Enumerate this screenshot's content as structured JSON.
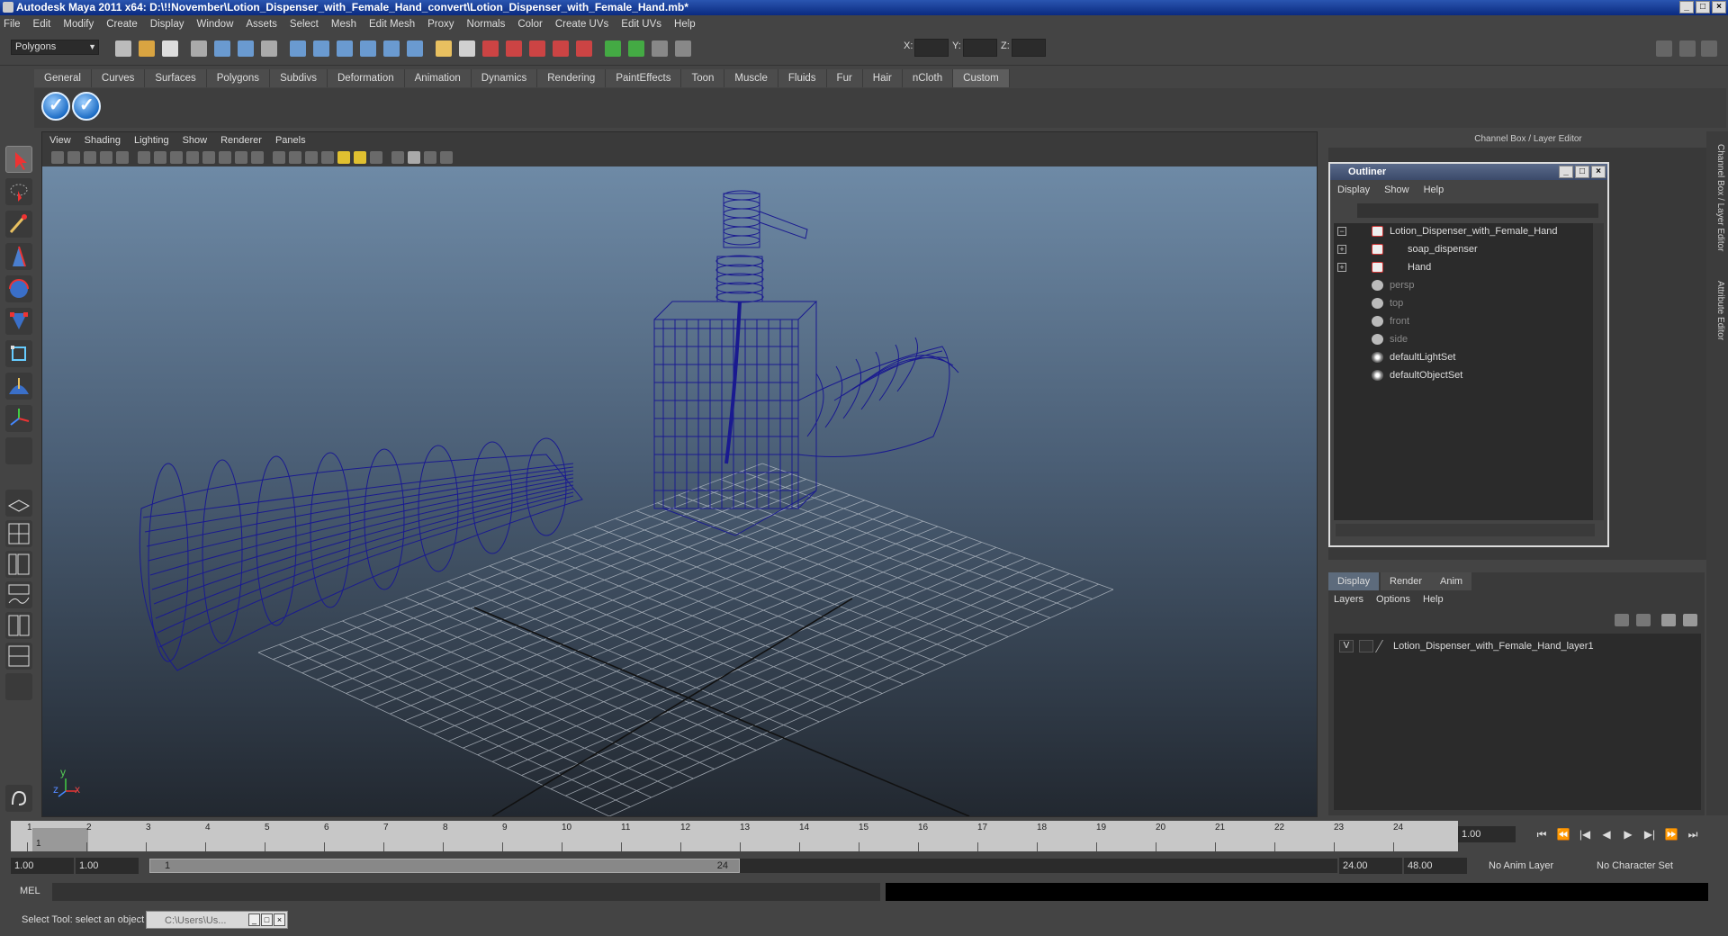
{
  "window": {
    "title": "Autodesk Maya 2011 x64: D:\\!!November\\Lotion_Dispenser_with_Female_Hand_convert\\Lotion_Dispenser_with_Female_Hand.mb*"
  },
  "menu": [
    "File",
    "Edit",
    "Modify",
    "Create",
    "Display",
    "Window",
    "Assets",
    "Select",
    "Mesh",
    "Edit Mesh",
    "Proxy",
    "Normals",
    "Color",
    "Create UVs",
    "Edit UVs",
    "Help"
  ],
  "status": {
    "mode": "Polygons",
    "x_label": "X:",
    "y_label": "Y:",
    "z_label": "Z:"
  },
  "shelf": {
    "tabs": [
      "General",
      "Curves",
      "Surfaces",
      "Polygons",
      "Subdivs",
      "Deformation",
      "Animation",
      "Dynamics",
      "Rendering",
      "PaintEffects",
      "Toon",
      "Muscle",
      "Fluids",
      "Fur",
      "Hair",
      "nCloth",
      "Custom"
    ],
    "active_tab": "Custom"
  },
  "viewport": {
    "menu": [
      "View",
      "Shading",
      "Lighting",
      "Show",
      "Renderer",
      "Panels"
    ],
    "axis_y": "y",
    "axis_x": "x",
    "axis_z": "z"
  },
  "right_panel": {
    "header": "Channel Box / Layer Editor",
    "vertical_tabs": [
      "Channel Box / Layer Editor",
      "Attribute Editor"
    ]
  },
  "outliner": {
    "title": "Outliner",
    "menu": [
      "Display",
      "Show",
      "Help"
    ],
    "items": [
      {
        "label": "Lotion_Dispenser_with_Female_Hand",
        "type": "transform",
        "expand": "−",
        "indent": 0,
        "dim": false
      },
      {
        "label": "soap_dispenser",
        "type": "transform",
        "expand": "+",
        "indent": 1,
        "dim": false
      },
      {
        "label": "Hand",
        "type": "transform",
        "expand": "+",
        "indent": 1,
        "dim": false
      },
      {
        "label": "persp",
        "type": "camera",
        "expand": "",
        "indent": 0,
        "dim": true
      },
      {
        "label": "top",
        "type": "camera",
        "expand": "",
        "indent": 0,
        "dim": true
      },
      {
        "label": "front",
        "type": "camera",
        "expand": "",
        "indent": 0,
        "dim": true
      },
      {
        "label": "side",
        "type": "camera",
        "expand": "",
        "indent": 0,
        "dim": true
      },
      {
        "label": "defaultLightSet",
        "type": "set",
        "expand": "",
        "indent": 0,
        "dim": false
      },
      {
        "label": "defaultObjectSet",
        "type": "set",
        "expand": "",
        "indent": 0,
        "dim": false
      }
    ]
  },
  "layer_editor": {
    "tabs": [
      "Display",
      "Render",
      "Anim"
    ],
    "active_tab": "Display",
    "menu": [
      "Layers",
      "Options",
      "Help"
    ],
    "layers": [
      {
        "visible": "V",
        "name": "Lotion_Dispenser_with_Female_Hand_layer1"
      }
    ]
  },
  "timeline": {
    "ticks": [
      "1",
      "2",
      "3",
      "4",
      "5",
      "6",
      "7",
      "8",
      "9",
      "10",
      "11",
      "12",
      "13",
      "14",
      "15",
      "16",
      "17",
      "18",
      "19",
      "20",
      "21",
      "22",
      "23",
      "24"
    ],
    "current_frame": "1",
    "current_field": "1.00"
  },
  "playback": {
    "buttons": [
      "⏮",
      "⏪",
      "|◀",
      "◀",
      "▶",
      "▶|",
      "⏩",
      "⏭"
    ]
  },
  "range": {
    "start": "1.00",
    "playback_start": "1.00",
    "thumb_start": "1",
    "thumb_end": "24",
    "playback_end": "24.00",
    "end": "48.00",
    "anim_layer": "No Anim Layer",
    "character_set": "No Character Set"
  },
  "command": {
    "label": "MEL"
  },
  "help": {
    "message": "Select Tool: select an object",
    "task": "C:\\Users\\Us..."
  },
  "colors": {
    "wire": "#1a1a90",
    "sky_top": "#6e8aa6",
    "ground": "#222830"
  }
}
